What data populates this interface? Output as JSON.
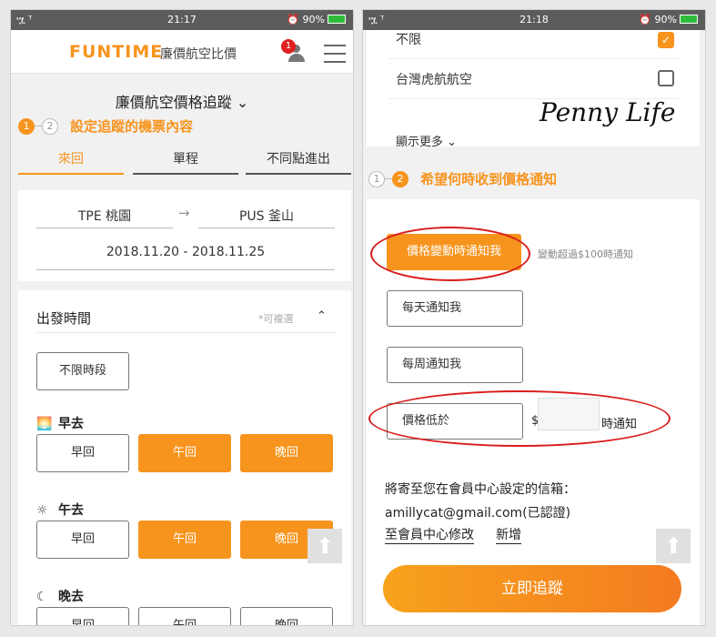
{
  "status": {
    "signal": "ሧ ᵀ",
    "battery": "90%",
    "alarm": "⏰"
  },
  "left": {
    "time": "21:17",
    "logo": "FUNTIME",
    "slogan": "廉價航空比價",
    "notification_count": "1",
    "page_title": "廉價航空價格追蹤",
    "step1": {
      "num1": "1",
      "num2": "2",
      "title": "設定追蹤的機票內容"
    },
    "tabs": [
      "來回",
      "單程",
      "不同點進出"
    ],
    "route": {
      "from": "TPE 桃園",
      "arrow": "→",
      "to": "PUS 釜山",
      "dates": "2018.11.20 - 2018.11.25"
    },
    "departure": {
      "title": "出發時間",
      "note": "*可複選",
      "caret": "⌃",
      "any": "不限時段",
      "morning": {
        "icon": "🌅",
        "label": "早去",
        "options": [
          "早回",
          "午回",
          "晚回"
        ]
      },
      "noon": {
        "icon": "☼",
        "label": "午去",
        "options": [
          "早回",
          "午回",
          "晚回"
        ]
      },
      "night": {
        "icon": "☾",
        "label": "晚去",
        "options": [
          "早回",
          "午回",
          "晚回"
        ]
      }
    },
    "to_top": "⬆"
  },
  "right": {
    "time": "21:18",
    "airlines": [
      {
        "name": "不限",
        "checked": true
      },
      {
        "name": "台灣虎航航空",
        "checked": false
      }
    ],
    "show_more": "顯示更多 ⌄",
    "watermark": "Penny Life",
    "step2": {
      "num1": "1",
      "num2": "2",
      "title": "希望何時收到價格通知"
    },
    "notify": {
      "on_change": "價格變動時通知我",
      "on_change_hint": "變動超過$100時通知",
      "daily": "每天通知我",
      "weekly": "每周通知我",
      "below": "價格低於",
      "currency": "$",
      "price_value": "",
      "suffix": "時通知"
    },
    "email": {
      "title": "將寄至您在會員中心設定的信箱：",
      "address": "amillycat@gmail.com(已認證)",
      "edit": "至會員中心修改",
      "add": "新增"
    },
    "track_button": "立即追蹤",
    "to_top": "⬆"
  }
}
